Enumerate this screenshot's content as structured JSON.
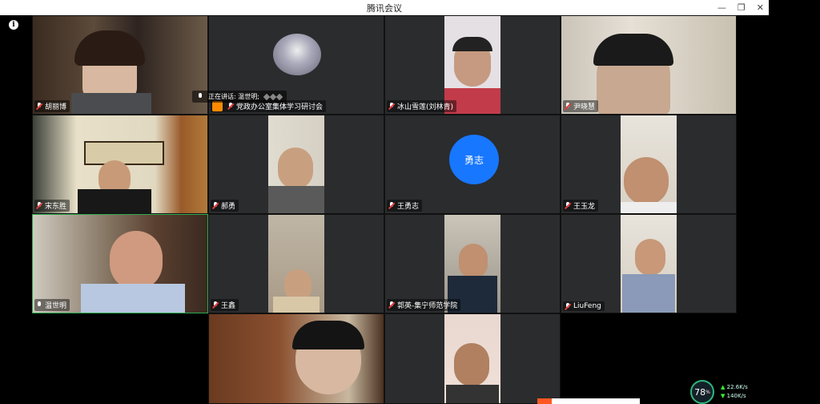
{
  "window": {
    "title": "腾讯会议"
  },
  "speaking": {
    "label": "正在讲话: 温世明;"
  },
  "tiles": [
    {
      "name": "胡丽博",
      "muted": true
    },
    {
      "name": "党政办公室集体学习研讨会",
      "muted": true,
      "host": true
    },
    {
      "name": "冰山雪莲(刘林青)",
      "muted": true
    },
    {
      "name": "尹晓慧",
      "muted": true
    },
    {
      "name": "宋东胜",
      "muted": true
    },
    {
      "name": "郝勇",
      "muted": true
    },
    {
      "name": "王勇志",
      "muted": true,
      "avatar_text": "勇志"
    },
    {
      "name": "王玉龙",
      "muted": true
    },
    {
      "name": "温世明",
      "muted": false
    },
    {
      "name": "王鑫",
      "muted": true
    },
    {
      "name": "郭英-集宁师范学院",
      "muted": true
    },
    {
      "name": "LiuFeng",
      "muted": true
    }
  ],
  "stats": {
    "cpu_percent": "78",
    "cpu_unit": "%",
    "upload": "22.6",
    "download": "140",
    "rate_unit": "K/s"
  },
  "colors": {
    "tile_bg": "#2b2c2e",
    "avatar_blue": "#1777ff",
    "active_border": "#2fa84f",
    "host_orange": "#ff8a00"
  }
}
